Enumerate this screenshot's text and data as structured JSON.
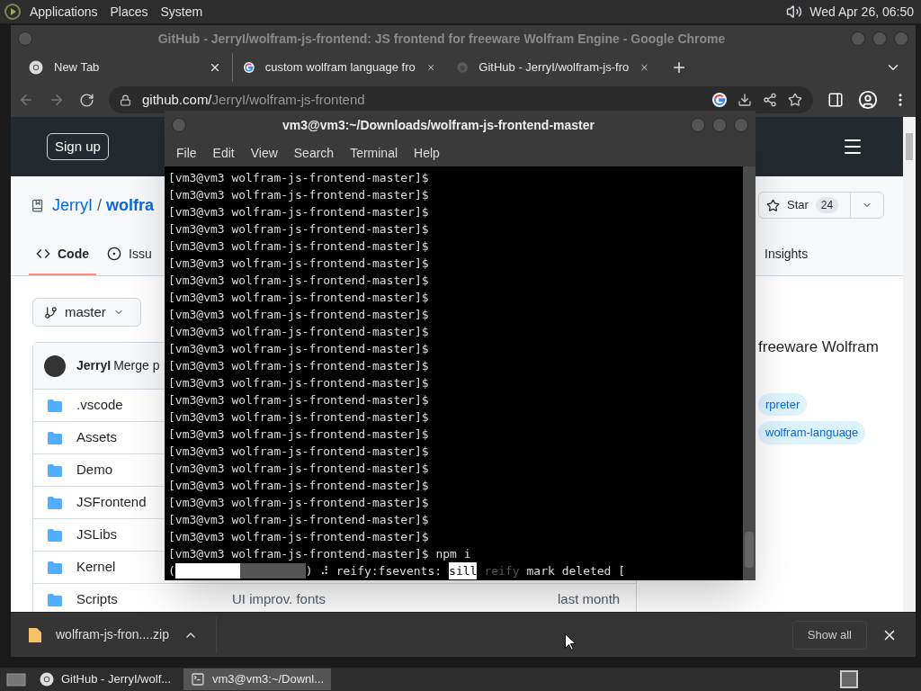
{
  "top_panel": {
    "menus": [
      "Applications",
      "Places",
      "System"
    ],
    "clock": "Wed Apr 26, 06:50"
  },
  "browser": {
    "title": "GitHub - JerryI/wolfram-js-frontend: JS frontend for freeware Wolfram Engine - Google Chrome",
    "tabs": [
      {
        "label": "New Tab",
        "kind": "chrome"
      },
      {
        "label": "custom wolfram language fro",
        "kind": "google"
      },
      {
        "label": "GitHub - JerryI/wolfram-js-fro",
        "kind": "github"
      }
    ],
    "address": {
      "host": "github.com/",
      "path": "JerryI/wolfram-js-frontend"
    },
    "page": {
      "sign_up": "Sign up",
      "owner": "JerryI",
      "separator": "/",
      "repo": "wolfra",
      "star": {
        "label": "Star",
        "count": "24"
      },
      "tabs": [
        {
          "label": "Code",
          "kind": "code",
          "selected": true
        },
        {
          "label": "Issu",
          "kind": "issue",
          "selected": false
        },
        {
          "label": "Insights",
          "kind": "plain",
          "selected": false
        }
      ],
      "branch": "master",
      "commit": {
        "author": "JerryI",
        "message": "Merge p"
      },
      "files": [
        {
          "name": ".vscode"
        },
        {
          "name": "Assets"
        },
        {
          "name": "Demo"
        },
        {
          "name": "JSFrontend"
        },
        {
          "name": "JSLibs"
        },
        {
          "name": "Kernel"
        },
        {
          "name": "Scripts",
          "message": "UI improv. fonts",
          "date": "last month"
        }
      ],
      "about": "freeware Wolfram",
      "topics": [
        "rpreter",
        "wolfram-language"
      ]
    },
    "downloads": {
      "file": "wolfram-js-fron....zip",
      "show_all": "Show all"
    }
  },
  "terminal": {
    "title": "vm3@vm3:~/Downloads/wolfram-js-frontend-master",
    "menus": [
      "File",
      "Edit",
      "View",
      "Search",
      "Terminal",
      "Help"
    ],
    "lines": [
      "[vm3@vm3 wolfram-js-frontend-master]$",
      "[vm3@vm3 wolfram-js-frontend-master]$",
      "[vm3@vm3 wolfram-js-frontend-master]$",
      "[vm3@vm3 wolfram-js-frontend-master]$",
      "[vm3@vm3 wolfram-js-frontend-master]$",
      "[vm3@vm3 wolfram-js-frontend-master]$",
      "[vm3@vm3 wolfram-js-frontend-master]$",
      "[vm3@vm3 wolfram-js-frontend-master]$",
      "[vm3@vm3 wolfram-js-frontend-master]$",
      "[vm3@vm3 wolfram-js-frontend-master]$",
      "[vm3@vm3 wolfram-js-frontend-master]$",
      "[vm3@vm3 wolfram-js-frontend-master]$",
      "[vm3@vm3 wolfram-js-frontend-master]$",
      "[vm3@vm3 wolfram-js-frontend-master]$",
      "[vm3@vm3 wolfram-js-frontend-master]$",
      "[vm3@vm3 wolfram-js-frontend-master]$",
      "[vm3@vm3 wolfram-js-frontend-master]$",
      "[vm3@vm3 wolfram-js-frontend-master]$",
      "[vm3@vm3 wolfram-js-frontend-master]$",
      "[vm3@vm3 wolfram-js-frontend-master]$",
      "[vm3@vm3 wolfram-js-frontend-master]$",
      "[vm3@vm3 wolfram-js-frontend-master]$",
      "[vm3@vm3 wolfram-js-frontend-master]$ npm i"
    ],
    "progress": {
      "open": "(",
      "level": 0.5,
      "close": ")",
      "spinner": "⠼",
      "segments": [
        {
          "text": "reify:fsevents:",
          "kind": "plain"
        },
        {
          "text": "sill",
          "kind": "highlight"
        },
        {
          "text": "reify",
          "kind": "dim"
        },
        {
          "text": "mark deleted [",
          "kind": "plain"
        }
      ]
    }
  },
  "taskbar": {
    "items": [
      {
        "label": "GitHub - JerryI/wolf...",
        "kind": "chrome",
        "selected": false
      },
      {
        "label": "vm3@vm3:~/Downl...",
        "kind": "terminal",
        "selected": true
      }
    ]
  }
}
